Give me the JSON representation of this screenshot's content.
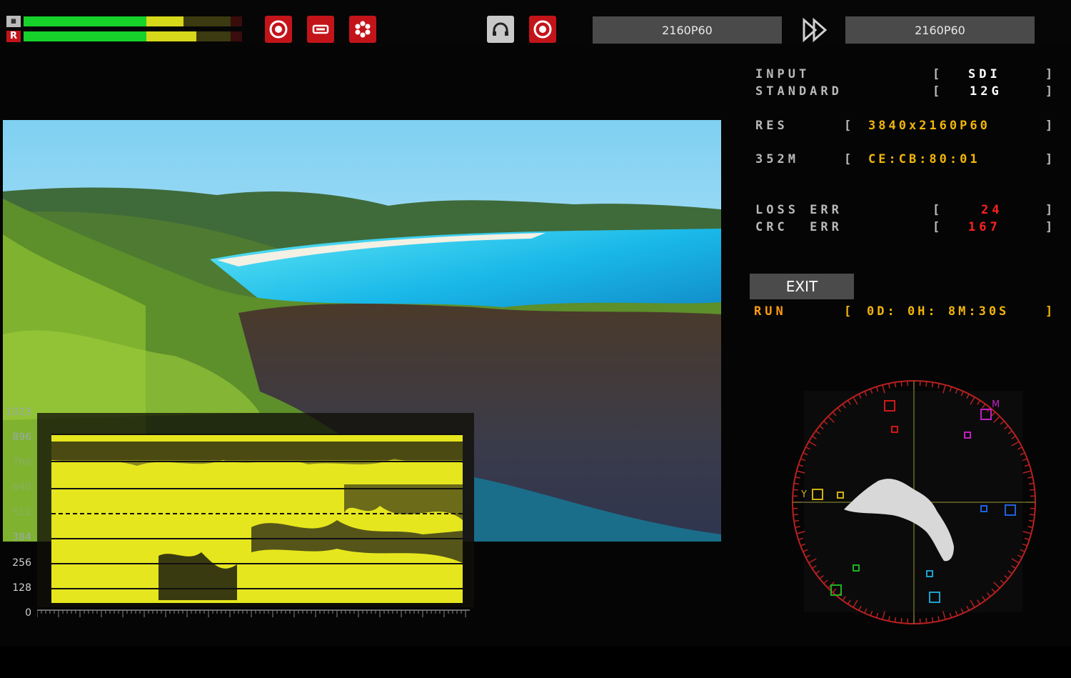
{
  "top_bar": {
    "meters": [
      {
        "channel": "L",
        "green": 0.53,
        "yellow": 0.17
      },
      {
        "channel": "R",
        "green": 0.53,
        "yellow": 0.22
      }
    ],
    "icons": [
      "settings-icon",
      "hdmi-port-icon",
      "audio-flower-icon",
      "headphone-icon",
      "target-icon"
    ],
    "input_format": "2160P60",
    "output_format": "2160P60"
  },
  "status": {
    "input_label": "INPUT",
    "input_value": "SDI",
    "standard_label": "STANDARD",
    "standard_value": "12G",
    "res_label": "RES",
    "res_value": "3840x2160P60",
    "s352m_label": "352M",
    "s352m_value": "CE:CB:80:01",
    "loss_label": "LOSS ERR",
    "loss_value": "24",
    "crc_label": "CRC  ERR",
    "crc_value": "167",
    "exit_label": "EXIT",
    "run_label": "RUN",
    "run_value": "0D: 0H: 8M:30S",
    "bracket_open": "[",
    "bracket_close": "]"
  },
  "waveform": {
    "y_labels": [
      "1023",
      "896",
      "768",
      "640",
      "512",
      "384",
      "256",
      "128",
      "0"
    ]
  },
  "vectorscope": {
    "targets": [
      "R",
      "M",
      "B",
      "C",
      "G",
      "Y"
    ],
    "labels": {
      "y": "Y",
      "m": "M"
    }
  },
  "colors": {
    "accent_red": "#c3141a",
    "meter_green": "#16d12a",
    "meter_yellow": "#d8d81a",
    "value_yellow": "#f2b50a",
    "error_red": "#ff2020",
    "run_orange": "#ff9c12"
  }
}
